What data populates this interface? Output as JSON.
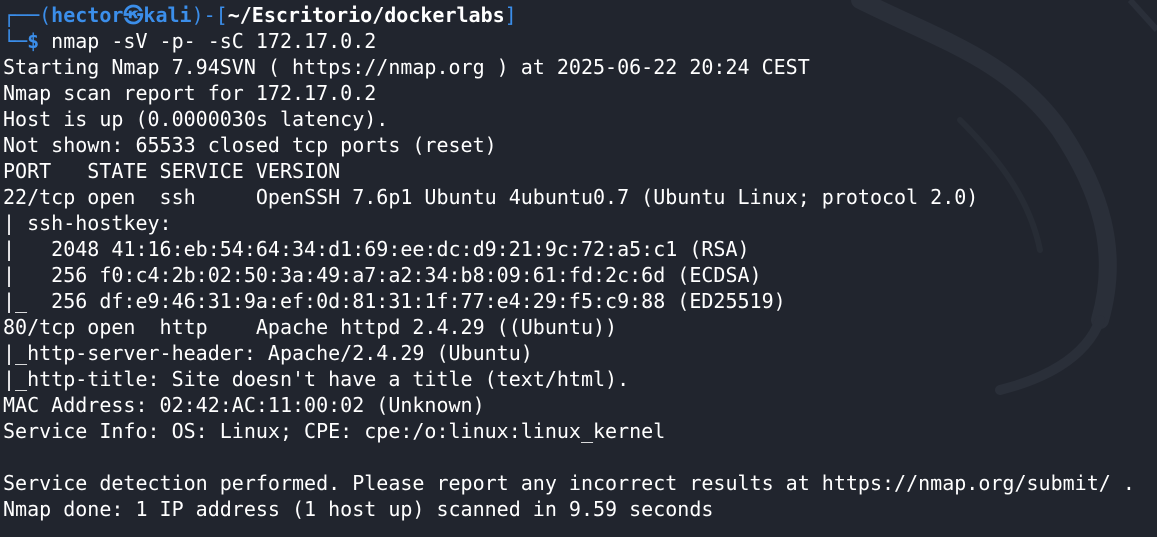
{
  "prompt": {
    "line1_prefix": "┌──(",
    "user": "hector",
    "host_separator": "㉿",
    "host": "kali",
    "close_paren": ")-[",
    "cwd": "~/Escritorio/dockerlabs",
    "close_bracket": "]",
    "line2_prefix": "└─",
    "dollar": "$",
    "command": " nmap -sV -p- -sC 172.17.0.2"
  },
  "output_lines": [
    "Starting Nmap 7.94SVN ( https://nmap.org ) at 2025-06-22 20:24 CEST",
    "Nmap scan report for 172.17.0.2",
    "Host is up (0.0000030s latency).",
    "Not shown: 65533 closed tcp ports (reset)",
    "PORT   STATE SERVICE VERSION",
    "22/tcp open  ssh     OpenSSH 7.6p1 Ubuntu 4ubuntu0.7 (Ubuntu Linux; protocol 2.0)",
    "| ssh-hostkey:",
    "|   2048 41:16:eb:54:64:34:d1:69:ee:dc:d9:21:9c:72:a5:c1 (RSA)",
    "|   256 f0:c4:2b:02:50:3a:49:a7:a2:34:b8:09:61:fd:2c:6d (ECDSA)",
    "|_  256 df:e9:46:31:9a:ef:0d:81:31:1f:77:e4:29:f5:c9:88 (ED25519)",
    "80/tcp open  http    Apache httpd 2.4.29 ((Ubuntu))",
    "|_http-server-header: Apache/2.4.29 (Ubuntu)",
    "|_http-title: Site doesn't have a title (text/html).",
    "MAC Address: 02:42:AC:11:00:02 (Unknown)",
    "Service Info: OS: Linux; CPE: cpe:/o:linux:linux_kernel",
    "",
    "Service detection performed. Please report any incorrect results at https://nmap.org/submit/ .",
    "Nmap done: 1 IP address (1 host up) scanned in 9.59 seconds"
  ],
  "colors": {
    "background": "#21252e",
    "prompt_blue": "#3b8eea",
    "text": "#ffffff"
  }
}
